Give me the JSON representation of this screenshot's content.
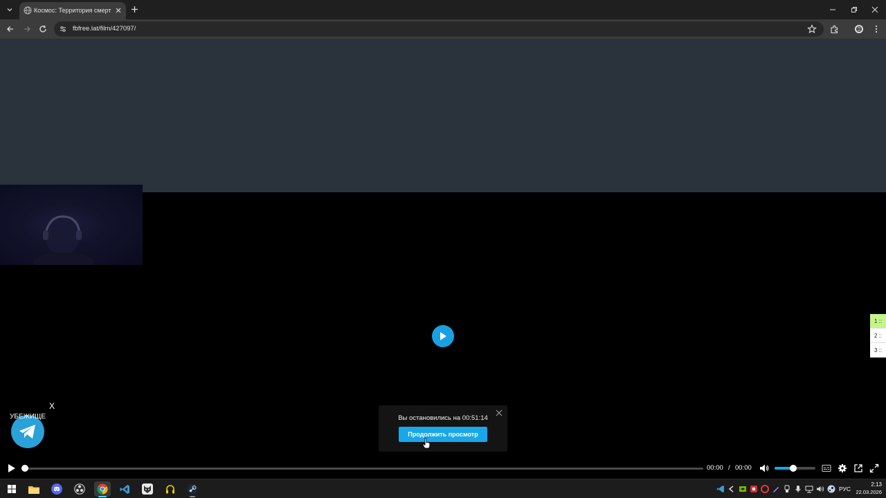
{
  "browser": {
    "tab_title": "Космос: Территория смерти (",
    "url": "fbfree.lat/film/427097/"
  },
  "side_tabs": [
    "1 ::",
    "2 ::",
    "3 ::"
  ],
  "telegram_widget": {
    "close_label": "X",
    "label": "УБЕЖИЩЕ"
  },
  "resume_popup": {
    "message": "Вы остановились на 00:51:14",
    "button_label": "Продолжить просмотр"
  },
  "player": {
    "current_time": "00:00",
    "time_separator": "/",
    "total_time": "00:00",
    "progress": 0,
    "volume": 0.45
  },
  "taskbar": {
    "language": "РУС",
    "time": "2:13",
    "date": "22.03.2026"
  },
  "colors": {
    "accent": "#19a7ea",
    "page_header_bg": "#2a323c",
    "active_side_tab": "#c4f58a"
  }
}
